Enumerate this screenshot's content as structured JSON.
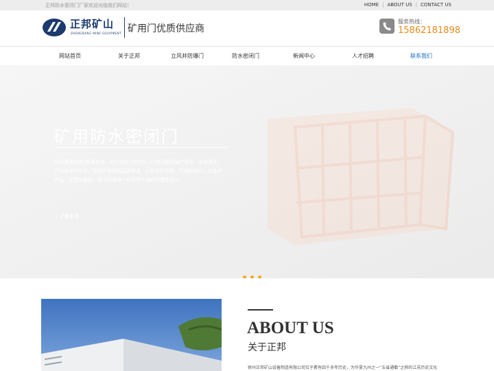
{
  "topbar": {
    "welcome": "正邦防水密闭门厂家欢迎光临我们网站！",
    "links": [
      "HOME",
      "ABOUT US",
      "CONTACT US"
    ]
  },
  "header": {
    "logo_cn": "正邦矿山",
    "logo_en": "ZHENGBANG MINE EQUIPMENT",
    "slogan": "矿用门优质供应商",
    "hotline_label": "服务热线：",
    "hotline_number": "15862181898"
  },
  "nav": {
    "items": [
      "网站首页",
      "关于正邦",
      "立风井防爆门",
      "防水密闭门",
      "新闻中心",
      "人才招聘",
      "联系我们"
    ],
    "active_index": 6
  },
  "banner": {
    "title": "矿用防水密闭门",
    "description": "公司秉承坚持“质量为本、客户为先”的宗旨，打造迅捷的客户服务，在设备生产的各道环节中，都是严格按照国家标准，以科学的管理、严谨的设计、完善的产品、优秀的服务，精心打造每一件优质产品的完整性设计。",
    "more": "+ 了解更多",
    "slide_count": 3
  },
  "about": {
    "title_en": "ABOUT US",
    "title_cn": "关于正邦",
    "intro": "徐州正邦矿山设备制造有限公司位于素有四千多年历史，为华夏九州之一“五省通衢”之称的江苏历史文化"
  },
  "colors": {
    "accent_orange": "#e98b1a",
    "nav_active": "#1c6fc5",
    "dot": "#f2a91e",
    "brand_blue": "#1b3a6e"
  }
}
